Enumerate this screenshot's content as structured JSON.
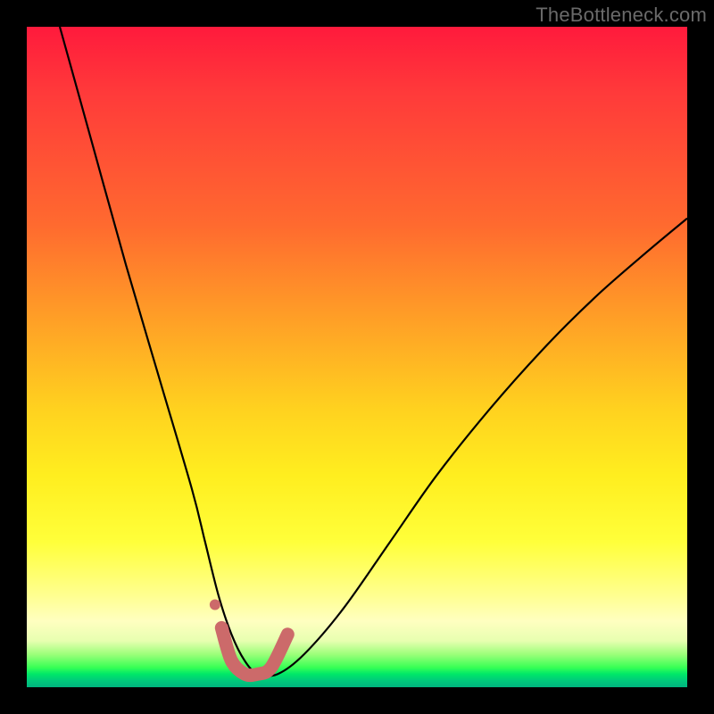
{
  "watermark": "TheBottleneck.com",
  "chart_data": {
    "type": "line",
    "title": "",
    "xlabel": "",
    "ylabel": "",
    "xlim": [
      0,
      100
    ],
    "ylim": [
      0,
      100
    ],
    "grid": false,
    "legend": false,
    "series": [
      {
        "name": "bottleneck-curve",
        "color": "#000000",
        "x": [
          5,
          10,
          15,
          20,
          25,
          27,
          29,
          31,
          33,
          35,
          38,
          42,
          48,
          55,
          62,
          70,
          78,
          86,
          94,
          100
        ],
        "values": [
          100,
          82,
          64,
          47,
          30,
          22,
          14,
          8,
          4,
          2,
          2,
          5,
          12,
          22,
          32,
          42,
          51,
          59,
          66,
          71
        ]
      },
      {
        "name": "highlight-u-segment",
        "color": "#cc6a6a",
        "x": [
          29.5,
          31,
          33,
          35,
          37,
          39.5
        ],
        "values": [
          9,
          4,
          2,
          2,
          3,
          8
        ]
      },
      {
        "name": "highlight-dot",
        "color": "#cc6a6a",
        "x": [
          28.5
        ],
        "values": [
          12.5
        ]
      }
    ],
    "background_gradient": {
      "stops": [
        {
          "pos": 0.0,
          "color": "#ff1a3c"
        },
        {
          "pos": 0.45,
          "color": "#ffa226"
        },
        {
          "pos": 0.78,
          "color": "#ffff3a"
        },
        {
          "pos": 0.93,
          "color": "#e7ffb0"
        },
        {
          "pos": 1.0,
          "color": "#00b47f"
        }
      ]
    }
  }
}
